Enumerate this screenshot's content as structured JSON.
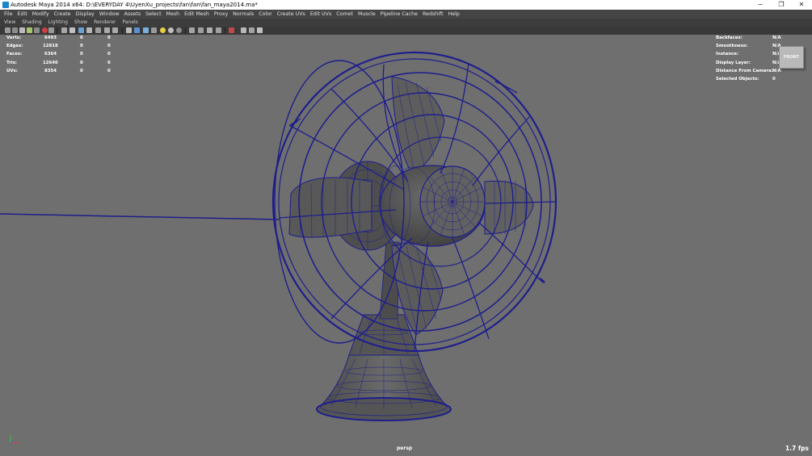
{
  "titlebar": {
    "title": "Autodesk Maya 2014 x64: D:\\EVERYDAY 4\\UyenXu_projects\\fan\\fan\\fan_maya2014.ma*",
    "minimize": "−",
    "restore": "❐",
    "close": "✕"
  },
  "menus": [
    "File",
    "Edit",
    "Modify",
    "Create",
    "Display",
    "Window",
    "Assets",
    "Select",
    "Mesh",
    "Edit Mesh",
    "Proxy",
    "Normals",
    "Color",
    "Create UVs",
    "Edit UVs",
    "Comet",
    "Muscle",
    "Pipeline Cache",
    "Redshift",
    "Help"
  ],
  "panel_menus": [
    "View",
    "Shading",
    "Lighting",
    "Show",
    "Renderer",
    "Panels"
  ],
  "hud_left": {
    "rows": [
      {
        "label": "Verts:",
        "v1": "6493",
        "v2": "0",
        "v3": "0"
      },
      {
        "label": "Edges:",
        "v1": "12818",
        "v2": "0",
        "v3": "0"
      },
      {
        "label": "Faces:",
        "v1": "6364",
        "v2": "0",
        "v3": "0"
      },
      {
        "label": "Tris:",
        "v1": "12640",
        "v2": "0",
        "v3": "0"
      },
      {
        "label": "UVs:",
        "v1": "8354",
        "v2": "0",
        "v3": "0"
      }
    ]
  },
  "hud_right": {
    "rows": [
      {
        "label": "Backfaces:",
        "value": "N/A"
      },
      {
        "label": "Smoothness:",
        "value": "N/A"
      },
      {
        "label": "Instance:",
        "value": "N/A"
      },
      {
        "label": "Display Layer:",
        "value": "N/A"
      },
      {
        "label": "Distance From Camera:",
        "value": "N/A"
      },
      {
        "label": "Selected Objects:",
        "value": "0"
      }
    ]
  },
  "viewcube": {
    "label": "FRONT"
  },
  "camera": {
    "name": "persp"
  },
  "fps": "1.7 fps",
  "colors": {
    "viewport_bg": "#6f6f6f",
    "wireframe": "#1e1e8c",
    "mesh_fill": "#5a5a5a"
  }
}
